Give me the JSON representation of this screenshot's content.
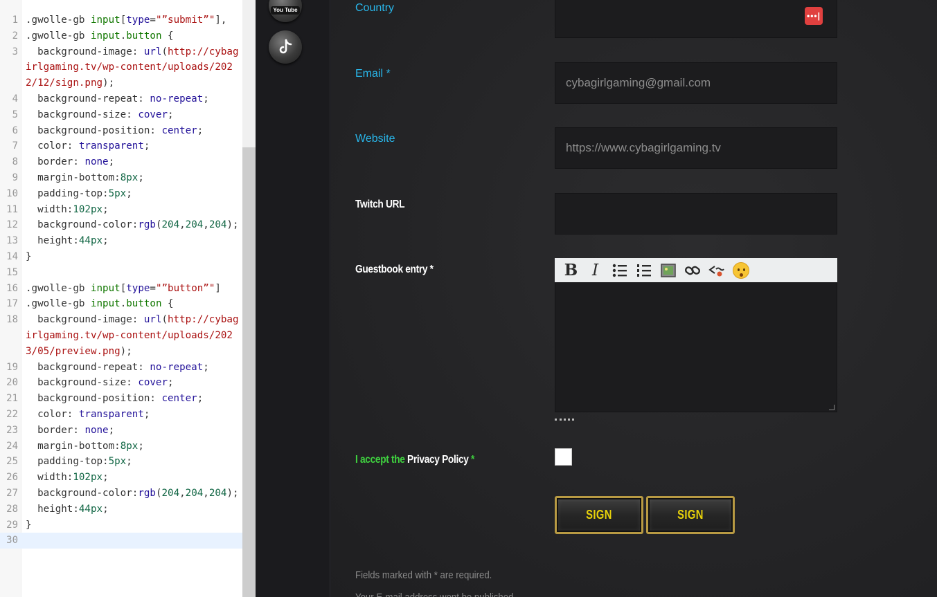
{
  "editor": {
    "lines": [
      {
        "n": "1",
        "html": "<span class=\"t-sel\">.gwolle-gb </span><span class=\"t-tag\">input</span>[<span class=\"t-attr\">type</span>=<span class=\"t-str\">\"”submit”\"</span>],"
      },
      {
        "n": "2",
        "html": "<span class=\"t-sel\">.gwolle-gb </span><span class=\"t-tag\">input</span>.<span class=\"t-tag\">button</span> {"
      },
      {
        "n": "3",
        "html": "  background-image: <span class=\"t-kw\">url</span>(<span class=\"t-url\">http://cybagirlgaming.tv/wp-content/uploads/2022/12/sign.png</span>);"
      },
      {
        "n": "4",
        "html": "  background-repeat: <span class=\"t-kw\">no-repeat</span>;"
      },
      {
        "n": "5",
        "html": "  background-size: <span class=\"t-kw\">cover</span>;"
      },
      {
        "n": "6",
        "html": "  background-position: <span class=\"t-kw\">center</span>;"
      },
      {
        "n": "7",
        "html": "  color: <span class=\"t-kw\">transparent</span>;"
      },
      {
        "n": "8",
        "html": "  border: <span class=\"t-kw\">none</span>;"
      },
      {
        "n": "9",
        "html": "  margin-bottom:<span class=\"t-num\">8px</span>;"
      },
      {
        "n": "10",
        "html": "  padding-top:<span class=\"t-num\">5px</span>;"
      },
      {
        "n": "11",
        "html": "  width:<span class=\"t-num\">102px</span>;"
      },
      {
        "n": "12",
        "html": "  background-color:<span class=\"t-kw\">rgb</span>(<span class=\"t-num\">204</span>,<span class=\"t-num\">204</span>,<span class=\"t-num\">204</span>);"
      },
      {
        "n": "13",
        "html": "  height:<span class=\"t-num\">44px</span>;"
      },
      {
        "n": "14",
        "html": "}"
      },
      {
        "n": "15",
        "html": ""
      },
      {
        "n": "16",
        "html": "<span class=\"t-sel\">.gwolle-gb </span><span class=\"t-tag\">input</span>[<span class=\"t-attr\">type</span>=<span class=\"t-str\">\"”button”\"</span>]"
      },
      {
        "n": "17",
        "html": "<span class=\"t-sel\">.gwolle-gb </span><span class=\"t-tag\">input</span>.<span class=\"t-tag\">button</span> {"
      },
      {
        "n": "18",
        "html": "  background-image: <span class=\"t-kw\">url</span>(<span class=\"t-url\">http://cybagirlgaming.tv/wp-content/uploads/2023/05/preview.png</span>);"
      },
      {
        "n": "19",
        "html": "  background-repeat: <span class=\"t-kw\">no-repeat</span>;"
      },
      {
        "n": "20",
        "html": "  background-size: <span class=\"t-kw\">cover</span>;"
      },
      {
        "n": "21",
        "html": "  background-position: <span class=\"t-kw\">center</span>;"
      },
      {
        "n": "22",
        "html": "  color: <span class=\"t-kw\">transparent</span>;"
      },
      {
        "n": "23",
        "html": "  border: <span class=\"t-kw\">none</span>;"
      },
      {
        "n": "24",
        "html": "  margin-bottom:<span class=\"t-num\">8px</span>;"
      },
      {
        "n": "25",
        "html": "  padding-top:<span class=\"t-num\">5px</span>;"
      },
      {
        "n": "26",
        "html": "  width:<span class=\"t-num\">102px</span>;"
      },
      {
        "n": "27",
        "html": "  background-color:<span class=\"t-kw\">rgb</span>(<span class=\"t-num\">204</span>,<span class=\"t-num\">204</span>,<span class=\"t-num\">204</span>);"
      },
      {
        "n": "28",
        "html": "  height:<span class=\"t-num\">44px</span>;"
      },
      {
        "n": "29",
        "html": "}"
      },
      {
        "n": "30",
        "html": ""
      }
    ]
  },
  "social": {
    "youtube_glyph": "You Tube",
    "tiktok_glyph": "♪"
  },
  "form": {
    "country_label": "Country",
    "country_badge": "•••|",
    "email_label": "Email *",
    "email_value": "cybagirlgaming@gmail.com",
    "website_label": "Website",
    "website_value": "https://www.cybagirlgaming.tv",
    "twitch_label": "Twitch URL",
    "entry_label": "Guestbook entry *",
    "toolbar": {
      "bold": "B",
      "italic": "I",
      "bullets": "☰",
      "numbered": "☷",
      "image": "▣",
      "link": "🔗",
      "code": "<≈"
    },
    "privacy_prefix": "I accept the ",
    "privacy_link": "Privacy Policy",
    "privacy_star": " *",
    "sign_label": "SIGN",
    "preview_label": "SIGN",
    "required_note": "Fields marked with * are required.",
    "email_note": "Your E-mail address wont be published."
  },
  "colors": {
    "label_blue": "#29b8ec",
    "accept_green": "#3fd13f",
    "badge_red": "#e0403f",
    "sign_yellow": "#e8d20a"
  }
}
